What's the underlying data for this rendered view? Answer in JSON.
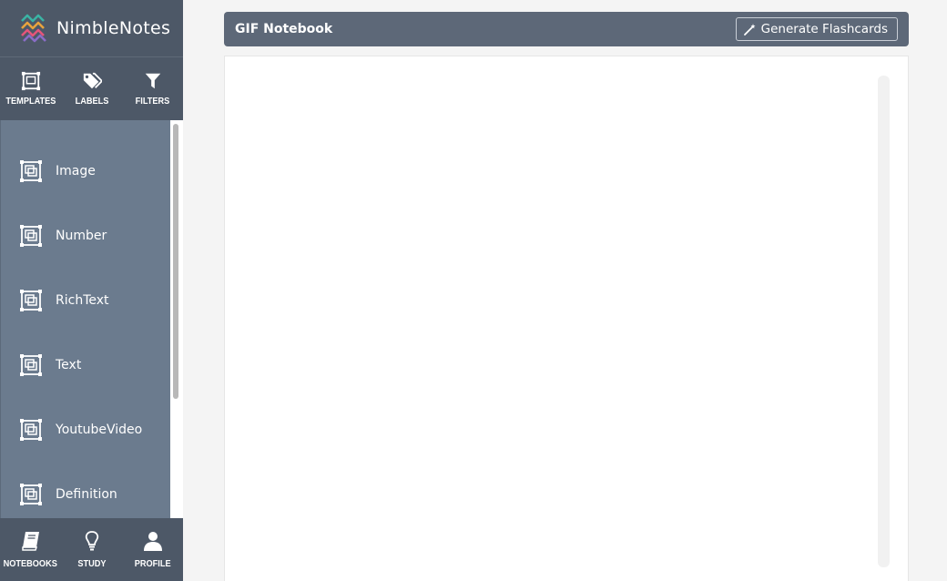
{
  "brand": {
    "name": "NimbleNotes"
  },
  "top_nav": [
    {
      "label": "TEMPLATES",
      "icon": "template-icon"
    },
    {
      "label": "LABELS",
      "icon": "tags-icon"
    },
    {
      "label": "FILTERS",
      "icon": "filter-icon"
    }
  ],
  "templates": [
    {
      "label": "Image"
    },
    {
      "label": "Number"
    },
    {
      "label": "RichText"
    },
    {
      "label": "Text"
    },
    {
      "label": "YoutubeVideo"
    },
    {
      "label": "Definition"
    }
  ],
  "bottom_nav": [
    {
      "label": "NOTEBOOKS",
      "icon": "book-icon"
    },
    {
      "label": "STUDY",
      "icon": "lightbulb-icon"
    },
    {
      "label": "PROFILE",
      "icon": "user-icon"
    }
  ],
  "notebook": {
    "title": "GIF Notebook",
    "generate_label": "Generate Flashcards"
  },
  "colors": {
    "nav_bg": "#4d5867",
    "list_bg": "#6b7b8e",
    "header_bg": "#5d6878"
  }
}
